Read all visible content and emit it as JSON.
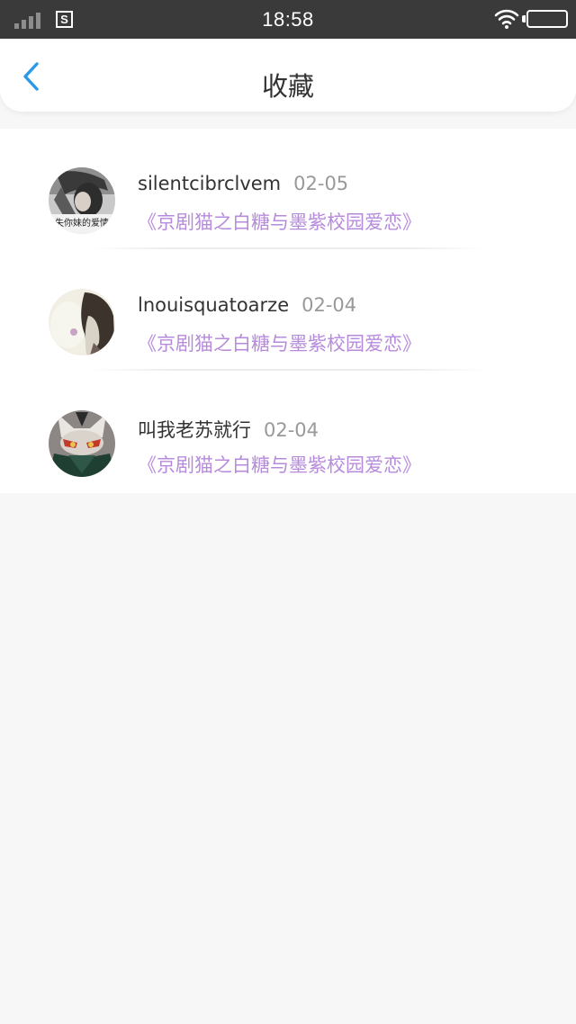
{
  "status_bar": {
    "time": "18:58",
    "sim_icon": "S",
    "icons": [
      "signal-icon",
      "sim-icon",
      "wifi-icon",
      "battery-icon"
    ]
  },
  "header": {
    "title": "收藏",
    "back_icon": "chevron-left-icon",
    "accent_color": "#2a9ae8"
  },
  "favorites": [
    {
      "username": "silentcibrclvem",
      "date": "02-05",
      "work": "《京剧猫之白糖与墨紫校园爱恋》",
      "avatar_text": "失你妹的爱情"
    },
    {
      "username": "lnouisquatoarze",
      "date": "02-04",
      "work": "《京剧猫之白糖与墨紫校园爱恋》"
    },
    {
      "username": "叫我老苏就行",
      "date": "02-04",
      "work": "《京剧猫之白糖与墨紫校园爱恋》"
    }
  ],
  "colors": {
    "link": "#b78bdc",
    "username": "#333333",
    "date": "#999999",
    "background": "#f7f7f7"
  }
}
